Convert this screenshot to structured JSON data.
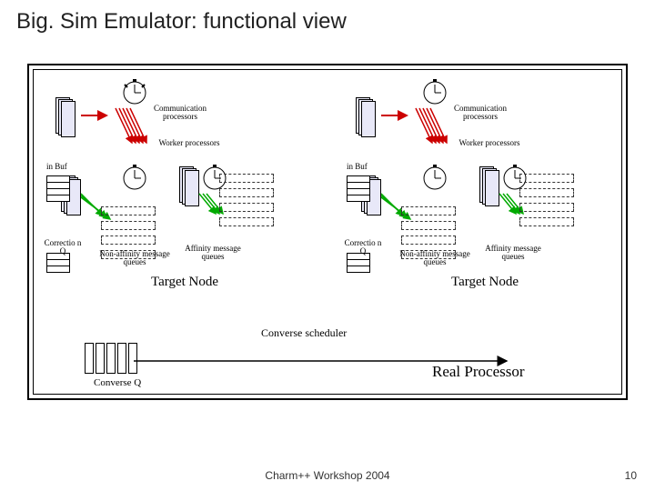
{
  "title": "Big. Sim Emulator: functional view",
  "node": {
    "comm_processors": "Communication processors",
    "worker_processors": "Worker processors",
    "in_buf": "in Buf",
    "correction_q": "Correctio n Q",
    "non_affinity": "Non-affinity message queues",
    "affinity": "Affinity message queues",
    "target": "Target Node"
  },
  "scheduler": "Converse scheduler",
  "converse_q": "Converse Q",
  "real_processor": "Real Processor",
  "footer": "Charm++ Workshop 2004",
  "page": "10"
}
